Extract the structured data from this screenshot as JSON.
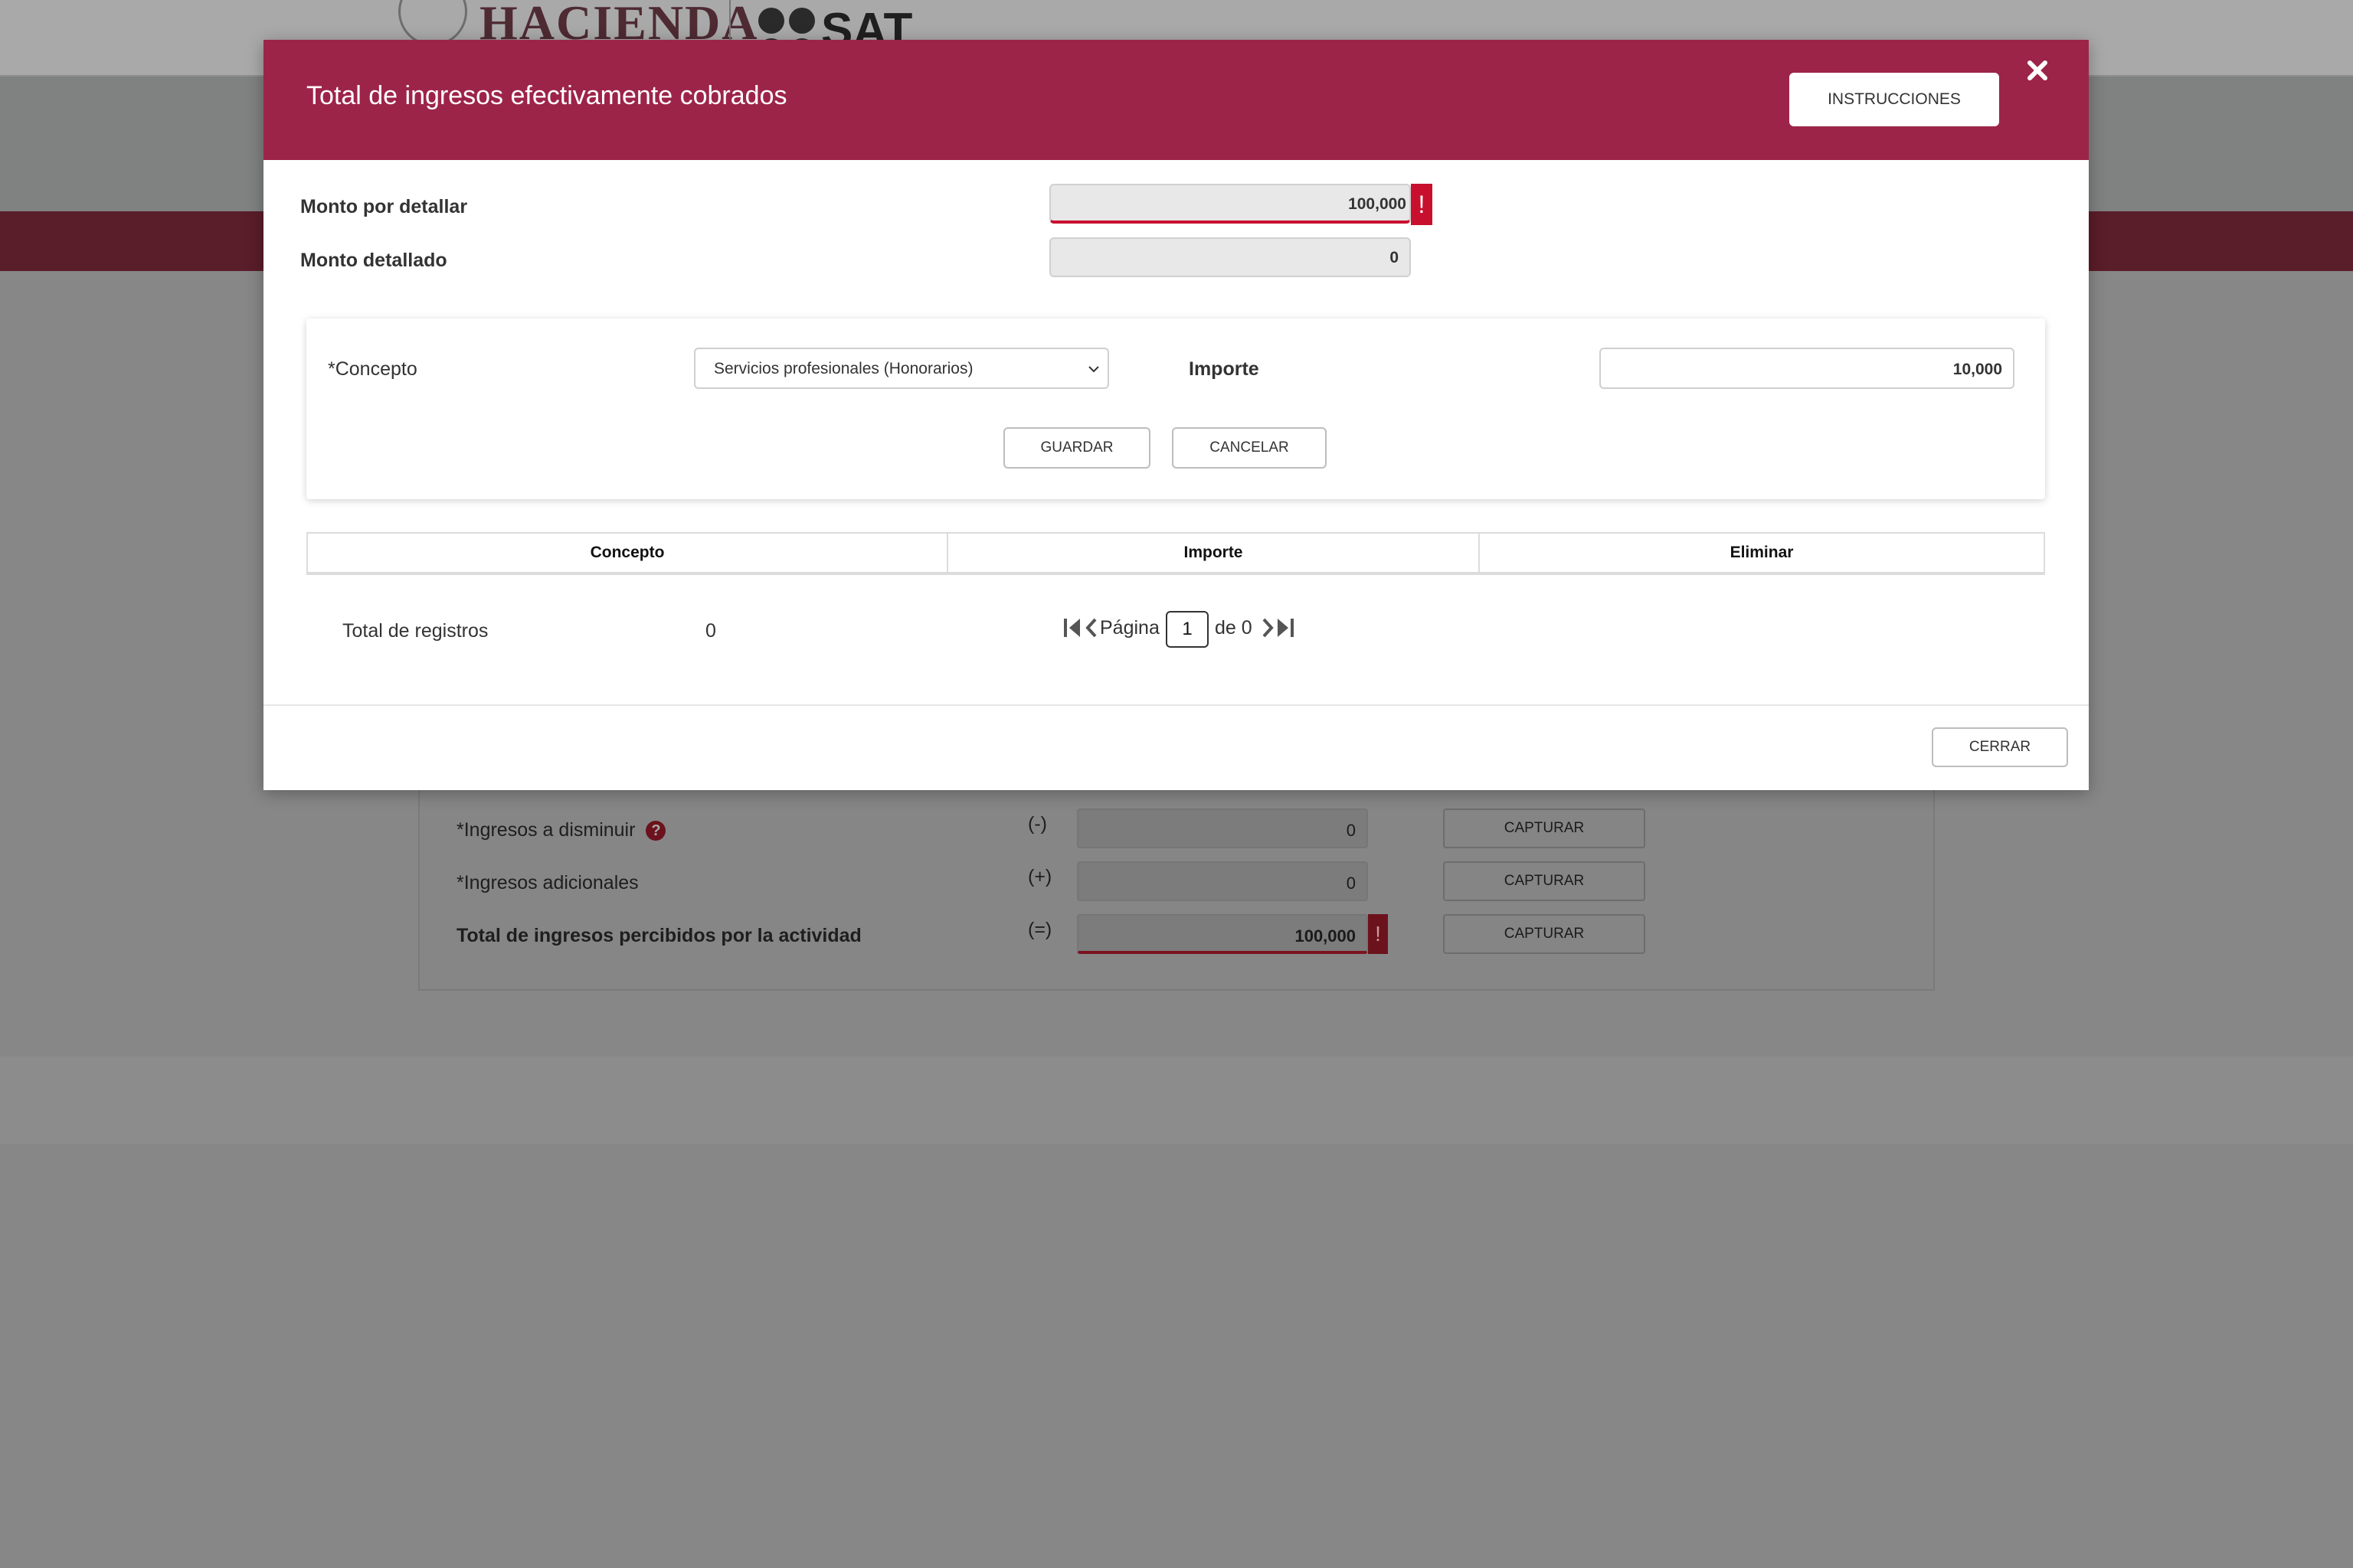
{
  "background": {
    "header": {
      "brand_left": "HACIENDA",
      "brand_right": "SAT"
    },
    "rows": [
      {
        "label": "*Ingresos a disminuir",
        "operator": "(-)",
        "value": "0",
        "button": "CAPTURAR",
        "has_help": true
      },
      {
        "label": "*Ingresos adicionales",
        "operator": "(+)",
        "value": "0",
        "button": "CAPTURAR",
        "has_help": false
      },
      {
        "label": "Total de ingresos percibidos por la actividad",
        "operator": "(=)",
        "value": "100,000",
        "button": "CAPTURAR",
        "has_error": true
      }
    ],
    "error_mark": "!"
  },
  "modal": {
    "title": "Total de ingresos efectivamente cobrados",
    "instructions_button": "INSTRUCCIONES",
    "monto_por_detallar": {
      "label": "Monto por detallar",
      "value": "100,000",
      "error_mark": "!"
    },
    "monto_detallado": {
      "label": "Monto detallado",
      "value": "0"
    },
    "form": {
      "concepto_label": "*Concepto",
      "concepto_selected": "Servicios profesionales (Honorarios)",
      "importe_label": "Importe",
      "importe_value": "10,000",
      "save_button": "GUARDAR",
      "cancel_button": "CANCELAR"
    },
    "table": {
      "columns": [
        "Concepto",
        "Importe",
        "Eliminar"
      ],
      "rows": []
    },
    "footer_info": {
      "total_label": "Total de registros",
      "total_value": "0",
      "page_label": "Página",
      "page_current": "1",
      "page_of": "de 0"
    },
    "close_button": "CERRAR"
  },
  "colors": {
    "brand": "#9d2449",
    "error": "#c8102e",
    "overlay": "#878787"
  }
}
